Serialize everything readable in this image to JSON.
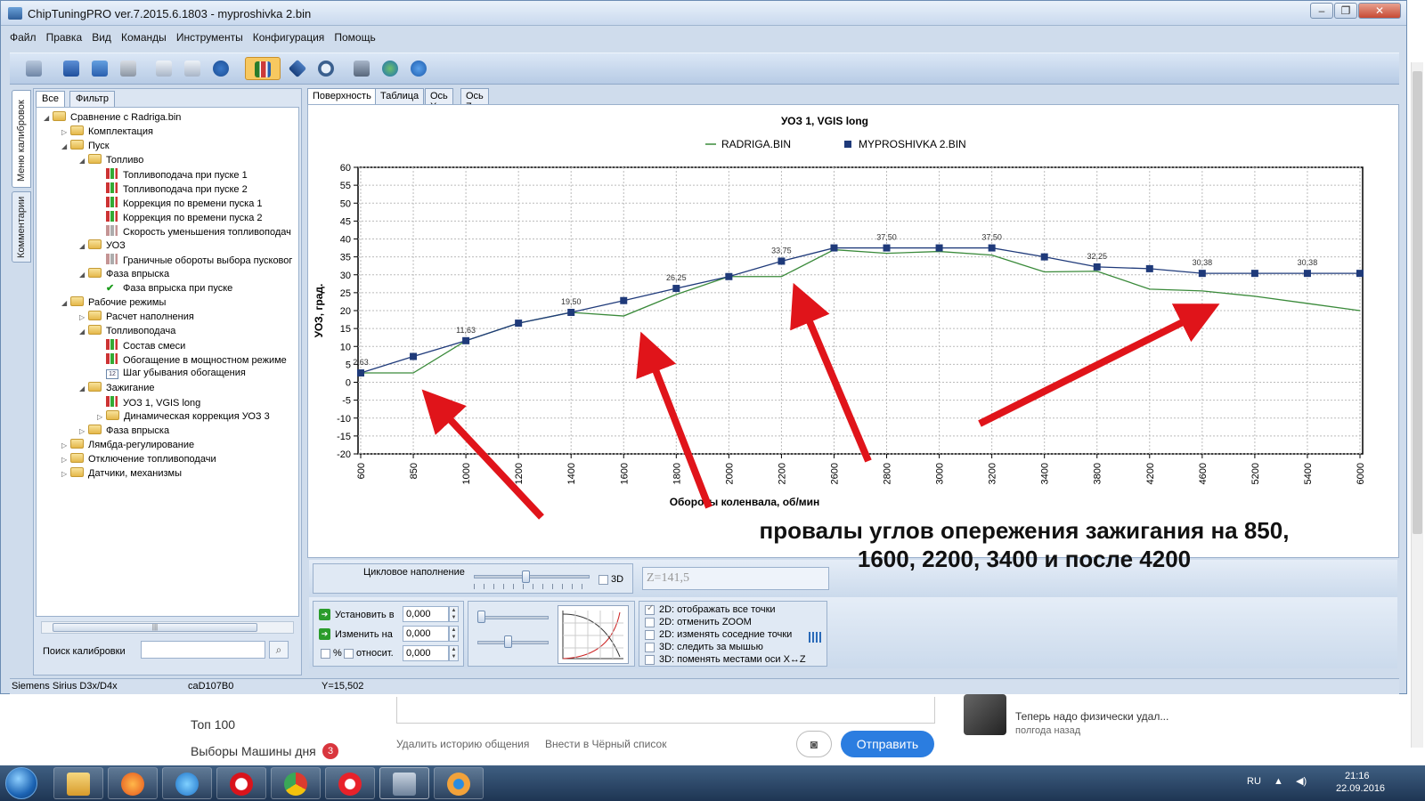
{
  "window": {
    "title": "ChipTuningPRO ver.7.2015.6.1803 - myproshivka 2.bin",
    "controls": [
      "–",
      "❐",
      "✕"
    ]
  },
  "menu": [
    "Файл",
    "Правка",
    "Вид",
    "Команды",
    "Инструменты",
    "Конфигурация",
    "Помощь"
  ],
  "toolbar": {
    "icons": [
      "open-icon",
      "save-icon",
      "save-as-icon",
      "print-icon",
      "copy-icon",
      "paste-icon",
      "undo-icon",
      "compare-icon",
      "diamond-icon",
      "zoom-icon",
      "tools-icon",
      "globe-icon",
      "help-icon"
    ]
  },
  "side_tabs": [
    "Меню калибровок",
    "Комментарии"
  ],
  "left_tabs": [
    "Все",
    "Фильтр"
  ],
  "tree": [
    {
      "label": "Сравнение с Radriga.bin",
      "level": 0,
      "kind": "folder",
      "exp": "◢"
    },
    {
      "label": "Комплектация",
      "level": 1,
      "kind": "folder",
      "exp": "▷"
    },
    {
      "label": "Пуск",
      "level": 1,
      "kind": "folder",
      "exp": "◢"
    },
    {
      "label": "Топливо",
      "level": 2,
      "kind": "folder",
      "exp": "◢"
    },
    {
      "label": "Топливоподача при пуске 1",
      "level": 3,
      "kind": "cal"
    },
    {
      "label": "Топливоподача при пуске 2",
      "level": 3,
      "kind": "cal"
    },
    {
      "label": "Коррекция по времени пуска 1",
      "level": 3,
      "kind": "cal"
    },
    {
      "label": "Коррекция по времени пуска 2",
      "level": 3,
      "kind": "cal"
    },
    {
      "label": "Скорость уменьшения топливоподач",
      "level": 3,
      "kind": "calflat"
    },
    {
      "label": "УОЗ",
      "level": 2,
      "kind": "folder",
      "exp": "◢"
    },
    {
      "label": "Граничные обороты выбора пусковог",
      "level": 3,
      "kind": "calflat"
    },
    {
      "label": "Фаза впрыска",
      "level": 2,
      "kind": "folder",
      "exp": "◢"
    },
    {
      "label": "Фаза впрыска при пуске",
      "level": 3,
      "kind": "check"
    },
    {
      "label": "Рабочие режимы",
      "level": 1,
      "kind": "folder",
      "exp": "◢"
    },
    {
      "label": "Расчет наполнения",
      "level": 2,
      "kind": "folder",
      "exp": "▷"
    },
    {
      "label": "Топливоподача",
      "level": 2,
      "kind": "folder",
      "exp": "◢"
    },
    {
      "label": "Состав смеси",
      "level": 3,
      "kind": "cal"
    },
    {
      "label": "Обогащение в мощностном режиме",
      "level": 3,
      "kind": "cal"
    },
    {
      "label": "Шаг убывания обогащения",
      "level": 3,
      "kind": "num"
    },
    {
      "label": "Зажигание",
      "level": 2,
      "kind": "folder",
      "exp": "◢"
    },
    {
      "label": "УОЗ 1, VGIS long",
      "level": 3,
      "kind": "cal"
    },
    {
      "label": "Динамическая коррекция УОЗ 3",
      "level": 3,
      "kind": "folder",
      "exp": "▷"
    },
    {
      "label": "Фаза впрыска",
      "level": 2,
      "kind": "folder",
      "exp": "▷"
    },
    {
      "label": "Лямбда-регулирование",
      "level": 1,
      "kind": "folder",
      "exp": "▷"
    },
    {
      "label": "Отключение топливоподачи",
      "level": 1,
      "kind": "folder",
      "exp": "▷"
    },
    {
      "label": "Датчики, механизмы",
      "level": 1,
      "kind": "folder",
      "exp": "▷"
    }
  ],
  "search": {
    "label": "Поиск калибровки",
    "value": ""
  },
  "view_tabs": [
    "Поверхность",
    "Таблица",
    "Ось X",
    "Ось Z"
  ],
  "chart_data": {
    "type": "line",
    "title": "УОЗ 1, VGIS long",
    "xlabel": "Обороты коленвала, об/мин",
    "ylabel": "УОЗ, град.",
    "categories": [
      "600",
      "850",
      "1000",
      "1200",
      "1400",
      "1600",
      "1800",
      "2000",
      "2200",
      "2600",
      "2800",
      "3000",
      "3200",
      "3400",
      "3800",
      "4200",
      "4600",
      "5200",
      "5400",
      "6000"
    ],
    "ylim": [
      -20,
      60
    ],
    "yticks": [
      60,
      55,
      50,
      45,
      40,
      35,
      30,
      25,
      20,
      15,
      10,
      5,
      0,
      -5,
      -10,
      -15,
      -20
    ],
    "grid": true,
    "legend": "top",
    "series": [
      {
        "name": "RADRIGA.BIN",
        "color": "#3a8a3a",
        "marker": "none",
        "values": [
          2.6,
          2.6,
          11.6,
          16.5,
          19.5,
          18.5,
          24.5,
          29.5,
          29.5,
          37.0,
          36.0,
          36.5,
          35.5,
          30.8,
          31.0,
          26.0,
          25.5,
          24.0,
          22.0,
          20.0
        ]
      },
      {
        "name": "MYPROSHIVKA 2.BIN",
        "color": "#1f3a7a",
        "marker": "square",
        "values": [
          2.6,
          7.2,
          11.6,
          16.5,
          19.5,
          22.8,
          26.2,
          29.5,
          33.8,
          37.5,
          37.5,
          37.5,
          37.5,
          35.0,
          32.2,
          31.7,
          30.4,
          30.4,
          30.4,
          30.4
        ]
      }
    ],
    "data_labels": [
      {
        "x": "600",
        "text": "2,63"
      },
      {
        "x": "1000",
        "text": "11,63"
      },
      {
        "x": "1400",
        "text": "19,50"
      },
      {
        "x": "1800",
        "text": "26,25"
      },
      {
        "x": "2200",
        "text": "33,75"
      },
      {
        "x": "2800",
        "text": "37,50"
      },
      {
        "x": "3200",
        "text": "37,50"
      },
      {
        "x": "3800",
        "text": "32,25"
      },
      {
        "x": "4600",
        "text": "30,38"
      },
      {
        "x": "5400",
        "text": "30,38"
      }
    ]
  },
  "annotation": "провалы углов опережения зажигания на 850, 1600, 2200, 3400 и после 4200",
  "controls": {
    "cycle_label": "Цикловое наполнение",
    "cb3d_label": "3D",
    "z_value": "Z=141,5",
    "set_label": "Установить в",
    "set_value": "0,000",
    "change_label": "Изменить на",
    "change_value": "0,000",
    "percent_label": "%",
    "relative_label": "относит.",
    "relative_value": "0,000",
    "options": [
      {
        "label": "2D: отображать все точки",
        "checked": true
      },
      {
        "label": "2D: отменить ZOOM",
        "checked": false
      },
      {
        "label": "2D: изменять соседние точки",
        "checked": false
      },
      {
        "label": "3D: следить за мышью",
        "checked": false
      },
      {
        "label": "3D: поменять местами оси X↔Z",
        "checked": false
      }
    ]
  },
  "status": {
    "ecu": "Siemens Sirius D3x/D4x",
    "id": "caD107B0",
    "y": "Y=15,502"
  },
  "background_page": {
    "link1": "Топ 100",
    "link2": "Выборы Машины дня",
    "badge": "3",
    "delete_history": "Удалить историю общения",
    "blacklist": "Внести в Чёрный список",
    "send": "Отправить",
    "msg_preview": "Теперь надо физически удал...",
    "msg_time": "полгода назад"
  },
  "tray": {
    "lang": "RU",
    "time": "21:16",
    "date": "22.09.2016"
  }
}
